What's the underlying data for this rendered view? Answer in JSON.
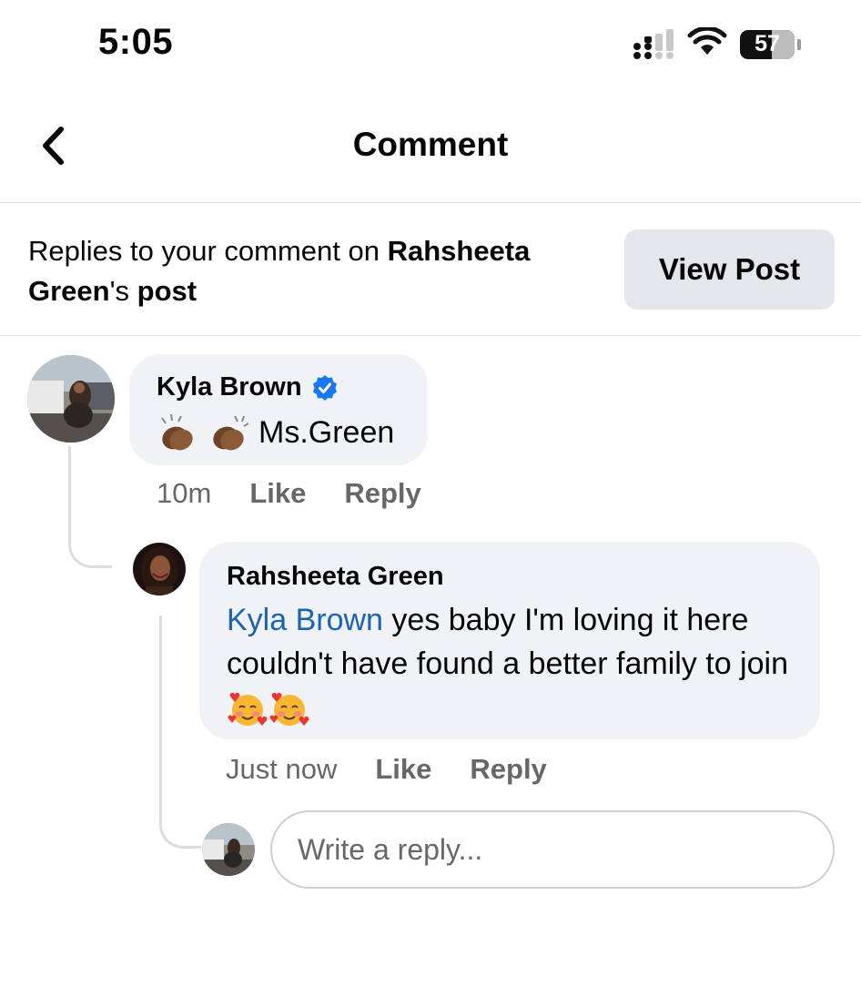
{
  "status_bar": {
    "time": "5:05",
    "battery": "57",
    "icons": [
      "cellular-signal-icon",
      "wifi-icon",
      "battery-icon"
    ]
  },
  "header": {
    "title": "Comment",
    "back_icon": "chevron-left-icon"
  },
  "banner": {
    "prefix": "Replies to your comment on ",
    "post_owner_first": "Rahsheeta",
    "post_owner_last": "Green",
    "suffix_possessive": "'s ",
    "suffix_post": "post",
    "view_post_label": "View Post"
  },
  "comment": {
    "author": "Kyla Brown",
    "verified_icon": "verified-badge-icon",
    "emoji": "clapping-hands-emoji",
    "text": "Ms.Green",
    "time": "10m",
    "like_label": "Like",
    "reply_label": "Reply"
  },
  "reply": {
    "author": "Rahsheeta Green",
    "mention": "Kyla Brown",
    "text": " yes baby I'm loving it here couldn't have found a better family to join",
    "emoji": "smiling-face-with-hearts-emoji",
    "time": "Just now",
    "like_label": "Like",
    "reply_label": "Reply"
  },
  "composer": {
    "placeholder": "Write a reply..."
  },
  "colors": {
    "bubble": "#f0f2f5",
    "button": "#e4e6eb",
    "mention": "#1b63b4",
    "verified": "#1877f2",
    "secondary_text": "#65676b"
  }
}
